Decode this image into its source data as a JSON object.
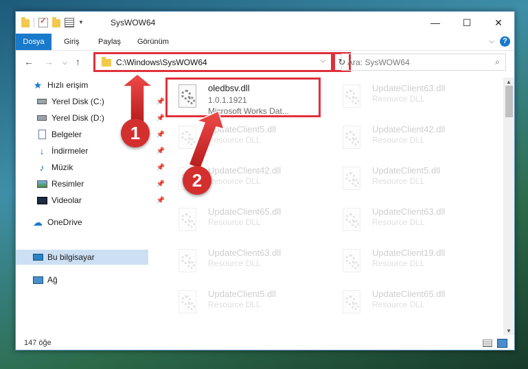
{
  "window": {
    "title": "SysWOW64",
    "controls": {
      "minimize": "—",
      "maximize": "☐",
      "close": "✕"
    }
  },
  "ribbon": {
    "tabs": [
      "Dosya",
      "Giriş",
      "Paylaş",
      "Görünüm"
    ],
    "help": "?"
  },
  "nav": {
    "address": "C:\\Windows\\SysWOW64",
    "search_placeholder": "Ara: SysWOW64"
  },
  "sidebar": {
    "items": [
      {
        "label": "Hızlı erişim",
        "icon": "star-icon"
      },
      {
        "label": "Yerel Disk (C:)",
        "icon": "disk-icon",
        "pinned": true
      },
      {
        "label": "Yerel Disk (D:)",
        "icon": "disk-icon",
        "pinned": true
      },
      {
        "label": "Belgeler",
        "icon": "document-icon",
        "pinned": true
      },
      {
        "label": "İndirmeler",
        "icon": "download-icon",
        "pinned": true
      },
      {
        "label": "Müzik",
        "icon": "music-icon",
        "pinned": true
      },
      {
        "label": "Resimler",
        "icon": "pictures-icon",
        "pinned": true
      },
      {
        "label": "Videolar",
        "icon": "videos-icon",
        "pinned": true
      },
      {
        "label": "OneDrive",
        "icon": "cloud-icon"
      },
      {
        "label": "Bu bilgisayar",
        "icon": "computer-icon",
        "selected": true
      },
      {
        "label": "Ağ",
        "icon": "network-icon"
      }
    ]
  },
  "files": [
    {
      "name": "oledbsv.dll",
      "line1": "1.0.1.1921",
      "line2": "Microsoft Works Dat...",
      "highlight": true
    },
    {
      "name": "UpdateClient63.dll",
      "line1": "Resource DLL"
    },
    {
      "name": "UpdateClient5.dll",
      "line1": "Resource DLL"
    },
    {
      "name": "UpdateClient42.dll",
      "line1": "Resource DLL"
    },
    {
      "name": "UpdateClient42.dll",
      "line1": "Resource DLL"
    },
    {
      "name": "UpdateClient5.dll",
      "line1": "Resource DLL"
    },
    {
      "name": "UpdateClient65.dll",
      "line1": "Resource DLL"
    },
    {
      "name": "UpdateClient63.dll",
      "line1": "Resource DLL"
    },
    {
      "name": "UpdateClient63.dll",
      "line1": "Resource DLL"
    },
    {
      "name": "UpdateClient19.dll",
      "line1": "Resource DLL"
    },
    {
      "name": "UpdateClient5.dll",
      "line1": "Resource DLL"
    },
    {
      "name": "UpdateClient65.dll",
      "line1": "Resource DLL"
    }
  ],
  "status": {
    "count": "147 öğe"
  },
  "annotations": [
    {
      "number": "1"
    },
    {
      "number": "2"
    }
  ]
}
